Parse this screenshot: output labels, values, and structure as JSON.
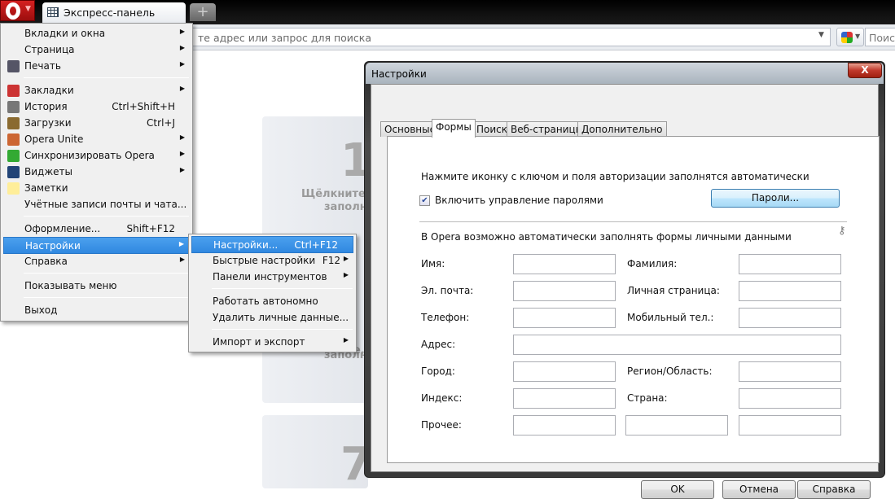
{
  "browser": {
    "tab_label": "Экспресс-панель",
    "address_placeholder": "те адрес или запрос для поиска",
    "search_placeholder": "Поиск",
    "speed_dial": [
      {
        "number": "1",
        "text_line1": "Щёлкните,",
        "text_line2": "заполн"
      },
      {
        "number": "7"
      }
    ],
    "tile_partial_text": [
      "е,",
      "заполн"
    ]
  },
  "main_menu": {
    "items": [
      {
        "label": "Вкладки и окна",
        "arrow": true
      },
      {
        "label": "Страница",
        "arrow": true
      },
      {
        "label": "Печать",
        "arrow": true,
        "icon": "printer-icon"
      },
      {
        "separator": true
      },
      {
        "label": "Закладки",
        "arrow": true,
        "icon": "bookmarks-icon"
      },
      {
        "label": "История",
        "shortcut": "Ctrl+Shift+H",
        "icon": "history-icon"
      },
      {
        "label": "Загрузки",
        "shortcut": "Ctrl+J",
        "icon": "downloads-icon"
      },
      {
        "label": "Opera Unite",
        "arrow": true,
        "icon": "unite-icon"
      },
      {
        "label": "Синхронизировать Opera",
        "arrow": true,
        "icon": "sync-icon"
      },
      {
        "label": "Виджеты",
        "arrow": true,
        "icon": "widgets-icon"
      },
      {
        "label": "Заметки",
        "icon": "notes-icon"
      },
      {
        "label": "Учётные записи почты и чата..."
      },
      {
        "separator": true
      },
      {
        "label": "Оформление...",
        "shortcut": "Shift+F12"
      },
      {
        "label": "Настройки",
        "arrow": true,
        "highlighted": true
      },
      {
        "label": "Справка",
        "arrow": true
      },
      {
        "separator": true
      },
      {
        "label": "Показывать меню"
      },
      {
        "separator": true
      },
      {
        "label": "Выход"
      }
    ]
  },
  "sub_menu": {
    "items": [
      {
        "label": "Настройки...",
        "shortcut": "Ctrl+F12",
        "highlighted": true
      },
      {
        "label": "Быстрые настройки",
        "shortcut": "F12",
        "arrow": true
      },
      {
        "label": "Панели инструментов",
        "arrow": true
      },
      {
        "separator": true
      },
      {
        "label": "Работать автономно"
      },
      {
        "label": "Удалить личные данные..."
      },
      {
        "separator": true
      },
      {
        "label": "Импорт и экспорт",
        "arrow": true
      }
    ]
  },
  "dialog": {
    "title": "Настройки",
    "close_label": "X",
    "tabs": [
      "Основные",
      "Формы",
      "Поиск",
      "Веб-страницы",
      "Дополнительно"
    ],
    "active_tab": "Формы",
    "key_hint": "Нажмите иконку с ключом и поля авторизации заполнятся автоматически",
    "password_checkbox_label": "Включить управление паролями",
    "password_checkbox_checked": true,
    "passwords_button": "Пароли...",
    "forms_intro": "В Opera возможно автоматически заполнять формы личными данными",
    "fields": {
      "first_name": {
        "label": "Имя",
        "value": ""
      },
      "last_name": {
        "label": "Фамилия",
        "value": ""
      },
      "email": {
        "label": "Эл. почта",
        "value": ""
      },
      "homepage": {
        "label": "Личная страница",
        "value": ""
      },
      "phone": {
        "label": "Телефон",
        "value": ""
      },
      "mobile": {
        "label": "Мобильный тел.",
        "value": ""
      },
      "address": {
        "label": "Адрес",
        "value": ""
      },
      "city": {
        "label": "Город",
        "value": ""
      },
      "region": {
        "label": "Регион/Область",
        "value": ""
      },
      "zip": {
        "label": "Индекс",
        "value": ""
      },
      "country": {
        "label": "Страна",
        "value": ""
      },
      "other": {
        "label": "Прочее",
        "value": ""
      }
    },
    "colon": ":",
    "ok": "OK",
    "cancel": "Отмена",
    "help": "Справка"
  }
}
